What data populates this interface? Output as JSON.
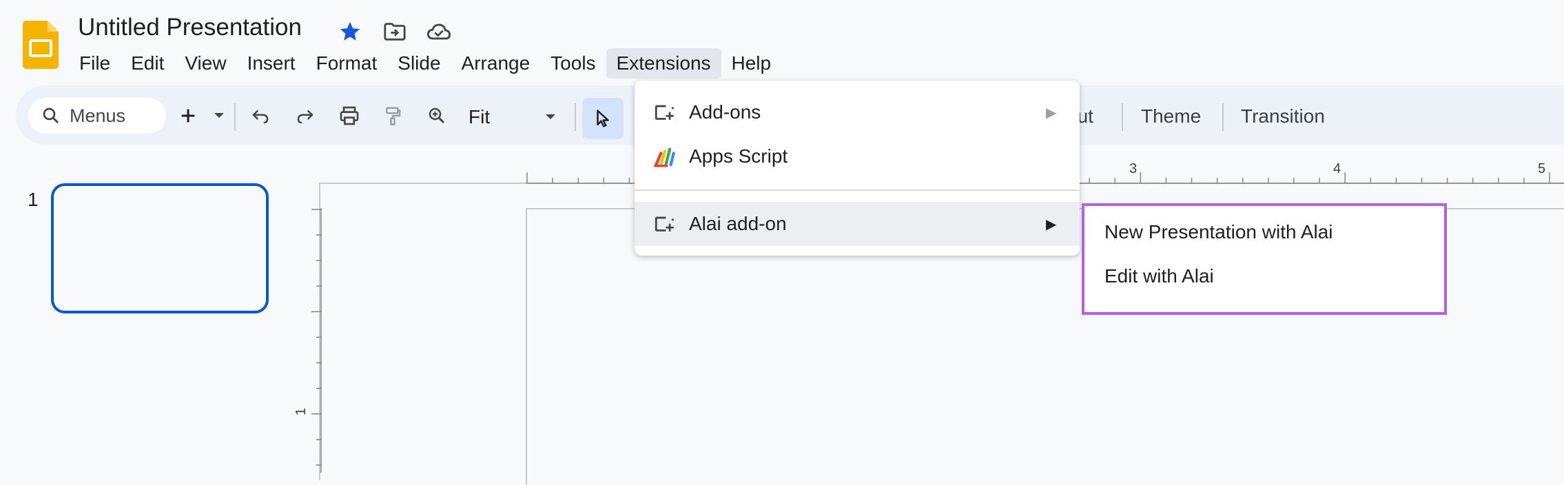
{
  "header": {
    "title": "Untitled Presentation",
    "icons": [
      "slides-logo-icon",
      "star-icon",
      "move-to-folder-icon",
      "cloud-saved-icon"
    ]
  },
  "menubar": {
    "items": [
      "File",
      "Edit",
      "View",
      "Insert",
      "Format",
      "Slide",
      "Arrange",
      "Tools",
      "Extensions",
      "Help"
    ],
    "active": "Extensions"
  },
  "toolbar": {
    "search_label": "Menus",
    "zoom_value": "Fit",
    "layout_partial": "out",
    "theme_label": "Theme",
    "transition_label": "Transition",
    "icons": [
      "search-icon",
      "add-icon",
      "dropdown-icon",
      "undo-icon",
      "redo-icon",
      "print-icon",
      "paint-format-icon",
      "zoom-icon",
      "select-cursor-icon"
    ]
  },
  "slides": {
    "numbers": [
      "1"
    ]
  },
  "ruler": {
    "horizontal_labels": [
      "3",
      "4",
      "5"
    ],
    "vertical_labels": [
      "1"
    ]
  },
  "extensions_menu": {
    "items": [
      {
        "label": "Add-ons",
        "icon": "add-on-icon",
        "has_submenu": true
      },
      {
        "label": "Apps Script",
        "icon": "apps-script-icon",
        "has_submenu": false
      },
      {
        "label": "Alai add-on",
        "icon": "add-on-icon",
        "has_submenu": true,
        "highlighted": true
      }
    ],
    "submenu_arrow": "▶"
  },
  "alai_submenu": {
    "items": [
      "New Presentation with Alai",
      "Edit with Alai"
    ],
    "highlight_color": "#b85de6"
  },
  "colors": {
    "accent": "#0b57d0",
    "star": "#1a56db",
    "slides_yellow": "#f4b400",
    "selection_bg": "#d3e3fd"
  }
}
